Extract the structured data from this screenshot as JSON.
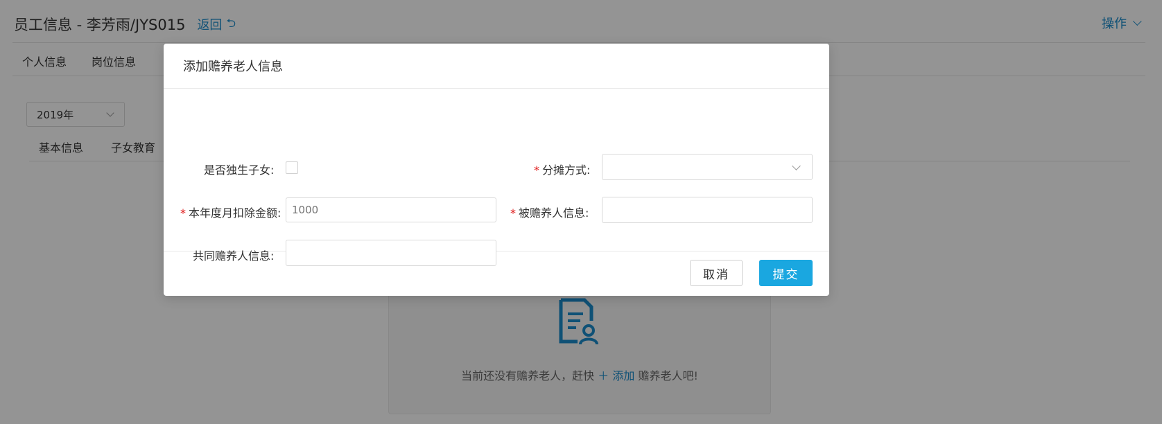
{
  "header": {
    "title": "员工信息 - 李芳雨/JYS015",
    "back_label": "返回",
    "ops_label": "操作"
  },
  "main_tabs": [
    "个人信息",
    "岗位信息"
  ],
  "year_select": {
    "value": "2019年"
  },
  "sub_tabs": [
    "基本信息",
    "子女教育"
  ],
  "empty_state": {
    "before": "当前还没有赡养老人，赶快",
    "add_label": "添加",
    "after": "赡养老人吧!"
  },
  "modal": {
    "title": "添加赡养老人信息",
    "fields": {
      "only_child_label": "是否独生子女:",
      "allocation_label": "分摊方式:",
      "monthly_deduction_label": "本年度月扣除金额:",
      "monthly_deduction_placeholder": "1000",
      "supported_person_label": "被赡养人信息:",
      "co_supporter_label": "共同赡养人信息:"
    },
    "cancel_label": "取消",
    "submit_label": "提交"
  },
  "colors": {
    "accent": "#1a8ccc",
    "primary_button": "#1aa7e0",
    "required": "#e02020"
  }
}
